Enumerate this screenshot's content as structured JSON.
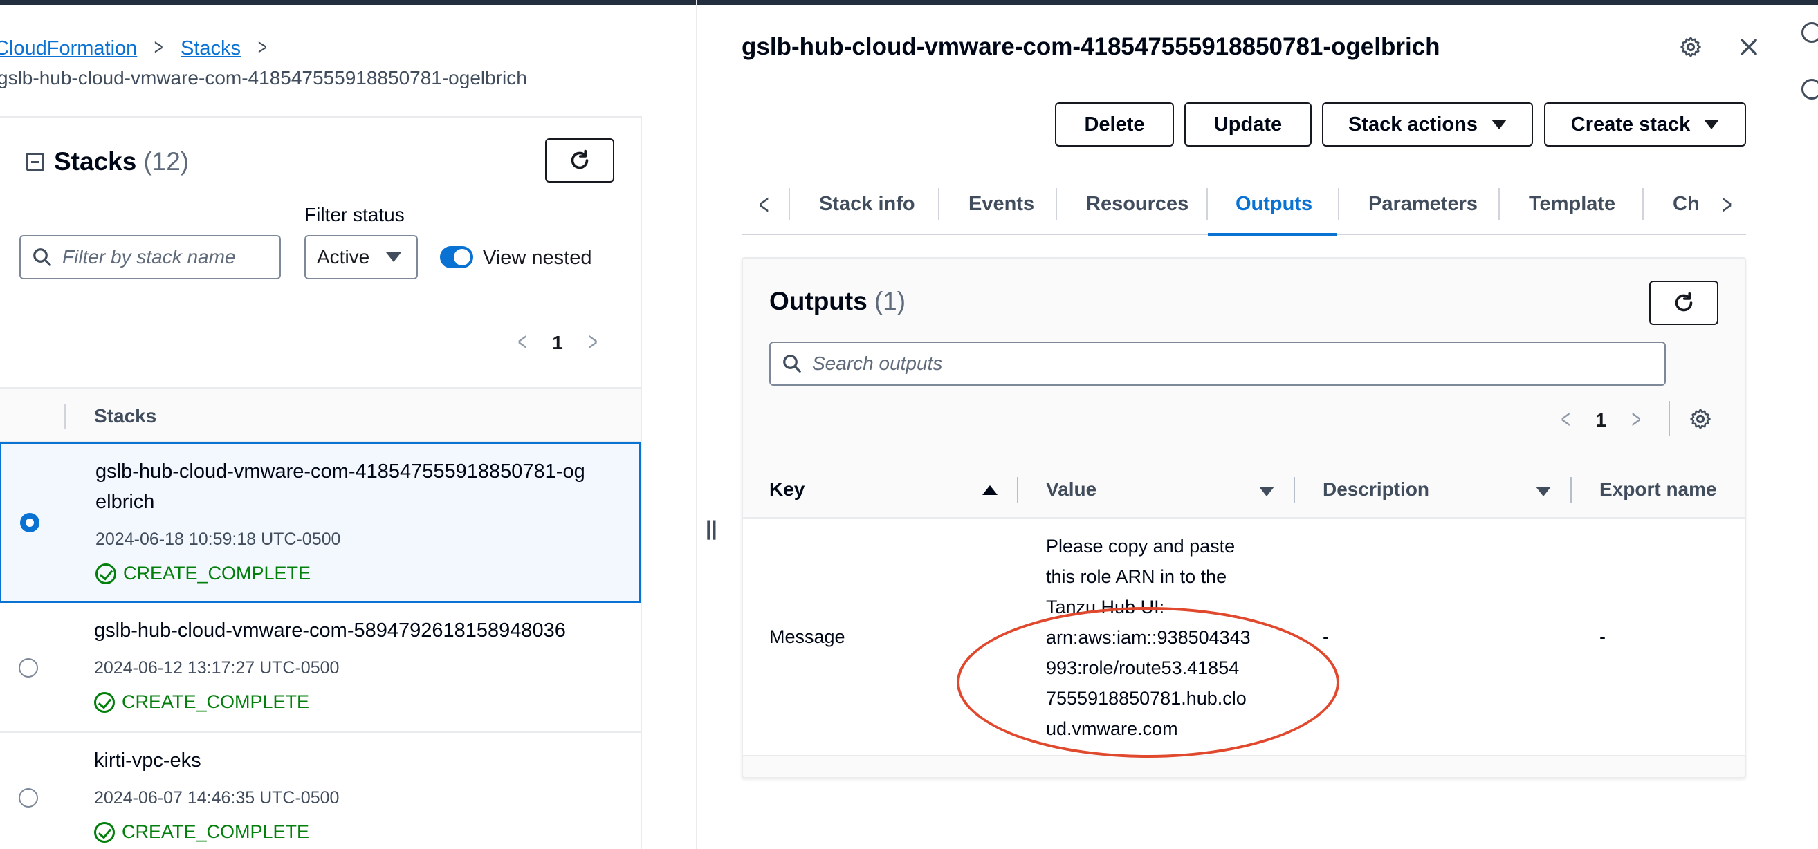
{
  "breadcrumb": {
    "items": [
      "CloudFormation",
      "Stacks"
    ],
    "current": "gslb-hub-cloud-vmware-com-418547555918850781-ogelbrich"
  },
  "stacks_panel": {
    "title": "Stacks",
    "count": "(12)",
    "filter_status_label": "Filter status",
    "search_placeholder": "Filter by stack name",
    "status_selected": "Active",
    "toggle_label": "View nested",
    "toggle_on": true,
    "page": "1",
    "column_header": "Stacks",
    "rows": [
      {
        "name": "gslb-hub-cloud-vmware-com-418547555918850781-ogelbrich",
        "date": "2024-06-18 10:59:18 UTC-0500",
        "status": "CREATE_COMPLETE",
        "selected": true
      },
      {
        "name": "gslb-hub-cloud-vmware-com-5894792618158948036",
        "date": "2024-06-12 13:17:27 UTC-0500",
        "status": "CREATE_COMPLETE",
        "selected": false
      },
      {
        "name": "kirti-vpc-eks",
        "date": "2024-06-07 14:46:35 UTC-0500",
        "status": "CREATE_COMPLETE",
        "selected": false
      }
    ]
  },
  "detail": {
    "title": "gslb-hub-cloud-vmware-com-418547555918850781-ogelbrich",
    "buttons": {
      "delete": "Delete",
      "update": "Update",
      "stack_actions": "Stack actions",
      "create_stack": "Create stack"
    },
    "tabs": [
      "Stack info",
      "Events",
      "Resources",
      "Outputs",
      "Parameters",
      "Template",
      "Ch"
    ],
    "active_tab": "Outputs",
    "outputs": {
      "title": "Outputs",
      "count": "(1)",
      "search_placeholder": "Search outputs",
      "page": "1",
      "columns": [
        "Key",
        "Value",
        "Description",
        "Export name"
      ],
      "row": {
        "key": "Message",
        "value_lines": [
          "Please copy and paste",
          "this role ARN in to the",
          "Tanzu Hub UI:",
          "arn:aws:iam::938504343",
          "993:role/route53.41854",
          "7555918850781.hub.clo",
          "ud.vmware.com"
        ],
        "description": "-",
        "export_name": "-"
      }
    }
  },
  "colors": {
    "accent": "#0972d3",
    "success": "#037f0c",
    "annotation": "#e0492d"
  },
  "icons": [
    "search-icon",
    "refresh-icon",
    "gear-icon",
    "close-icon",
    "check-circle-icon",
    "chevron-left-icon",
    "chevron-right-icon",
    "caret-down-icon",
    "sort-asc-icon",
    "sort-desc-icon"
  ]
}
